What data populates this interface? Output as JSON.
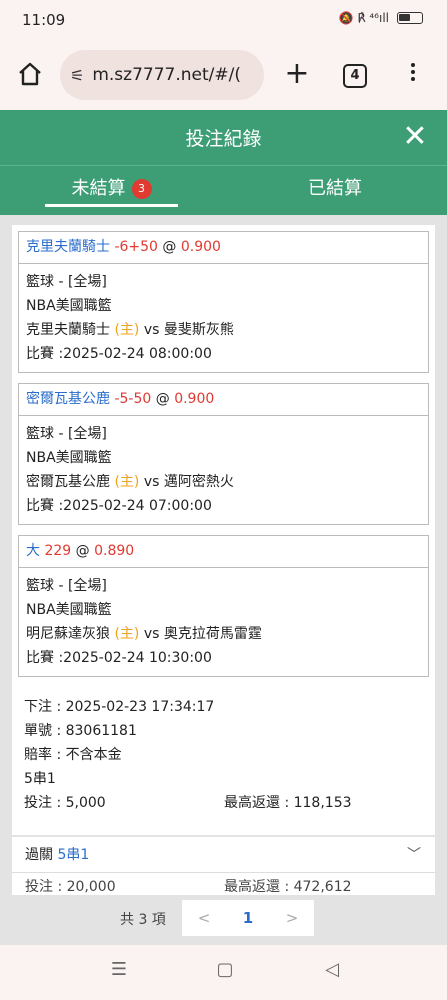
{
  "status_bar": {
    "time": "11:09",
    "signal_text": "🔕 ℟ ⁴⁶ıll"
  },
  "browser": {
    "url": "m.sz7777.net/#/(",
    "tab_count": "4",
    "plus": "+"
  },
  "header": {
    "title": "投注紀錄",
    "close": "✕"
  },
  "tabs": {
    "unsettled_label": "未結算",
    "unsettled_badge": "3",
    "settled_label": "已結算"
  },
  "bets": [
    {
      "team": "克里夫蘭騎士",
      "line": "-6+50",
      "at": "@",
      "odds": "0.900",
      "sport": "籃球 - [全場]",
      "league": "NBA美國職籃",
      "home": "克里夫蘭騎士",
      "home_tag": "(主)",
      "vs": "vs",
      "away": "曼斐斯灰熊",
      "match": "比賽 :2025-02-24 08:00:00"
    },
    {
      "team": "密爾瓦基公鹿",
      "line": "-5-50",
      "at": "@",
      "odds": "0.900",
      "sport": "籃球 - [全場]",
      "league": "NBA美國職籃",
      "home": "密爾瓦基公鹿",
      "home_tag": "(主)",
      "vs": "vs",
      "away": "邁阿密熱火",
      "match": "比賽 :2025-02-24 07:00:00"
    },
    {
      "team": "大",
      "line": "229",
      "at": "@",
      "odds": "0.890",
      "sport": "籃球 - [全場]",
      "league": "NBA美國職籃",
      "home": "明尼蘇達灰狼",
      "home_tag": "(主)",
      "vs": "vs",
      "away": "奧克拉荷馬雷霆",
      "match": "比賽 :2025-02-24 10:30:00"
    }
  ],
  "summary": {
    "placed": "下注 : 2025-02-23 17:34:17",
    "order_no": "單號 : 83061181",
    "odds_type": "賠率 : 不含本金",
    "parlay": "5串1",
    "stake": "投注 : 5,000",
    "max_return": "最高返還 : 118,153"
  },
  "parlay_card": {
    "label": "過關",
    "type": "5串1",
    "chevron": "﹀",
    "stake": "投注 : 20,000",
    "max_return": "最高返還 : 472,612"
  },
  "pager": {
    "total": "共 3 項",
    "prev": "<",
    "page": "1",
    "next": ">"
  },
  "nav": {
    "menu": "☰",
    "home": "▢",
    "back": "◁"
  },
  "colors": {
    "header_green": "#3d9e76",
    "link_blue": "#2a6dcc",
    "odds_red": "#e03a31",
    "home_orange": "#f0a020"
  }
}
